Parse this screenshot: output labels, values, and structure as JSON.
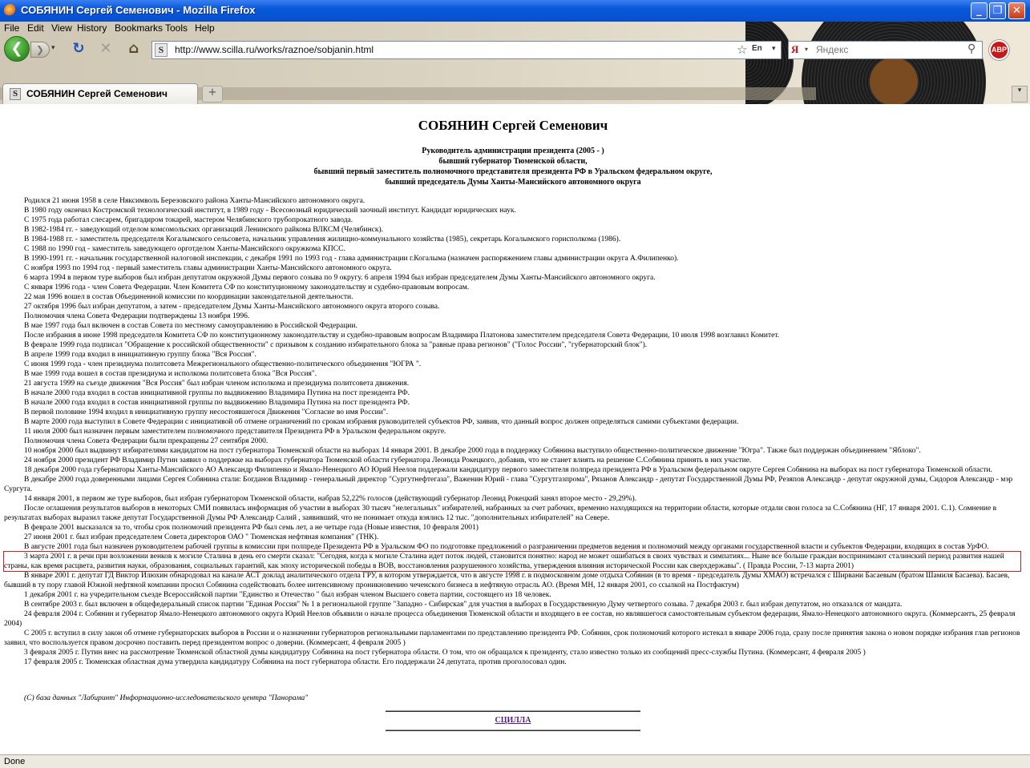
{
  "window": {
    "title": "СОБЯНИН Сергей Семенович - Mozilla Firefox",
    "min": "_",
    "max": "❐",
    "close": "✕"
  },
  "menu": [
    "File",
    "Edit",
    "View",
    "History",
    "Bookmarks",
    "Tools",
    "Help"
  ],
  "nav": {
    "back": "❮",
    "forward": "❯",
    "reload": "↻",
    "stop": "✕",
    "home": "⌂",
    "url": "http://www.scilla.ru/works/raznoe/sobjanin.html",
    "site_icon": "S",
    "star": "☆",
    "lang": "En",
    "search_engine": "Я",
    "search_placeholder": "Яндекс",
    "abp": "ABP"
  },
  "tab": {
    "favicon": "S",
    "label": "СОБЯНИН Сергей Семенович",
    "new_tab": "+",
    "all_tabs": "▾"
  },
  "page": {
    "title": "СОБЯНИН Сергей Семенович",
    "subtitle": [
      "Руководитель администрации президента (2005 - )",
      "бывший губернатор Тюменской области,",
      "бывший первый заместитель полномочного представителя президента РФ в Уральском федеральном округе,",
      "бывший председатель Думы Ханты-Мансийского автономного округа"
    ],
    "bio": [
      "Родился 21 июня 1958 в селе Няксимволь Березовского района  Ханты-Мансийского автономного округа.",
      "В 1980 году окончил Костромской технологический институт, в 1989 году - Всесоюзный юридический заочный институт. Кандидат юридических наук.",
      "С 1975 года работал слесарем, бригадиром токарей, мастером Челябинского трубопрокатного завода.",
      "В 1982-1984 гг. - заведующий отделом комсомольских организаций Ленинского райкома ВЛКСМ (Челябинск).",
      "В 1984-1988 гг. - заместитель председателя Когалымского сельсовета, начальник управления жилищно-коммунального хозяйства (1985), секретарь Когалымского горисполкома (1986).",
      "С 1988 по 1990 год - заместитель заведующего орготделом Ханты-Мансийского окружкома КПСС.",
      "В 1990-1991 гг. - начальник государственной налоговой инспекции, с декабря 1991 по 1993 год - глава администрации г.Когалыма (назначен распоряжением главы администрации округа А.Филипенко).",
      "С ноября 1993 по 1994 год - первый заместитель главы администрации Ханты-Мансийского автономного округа.",
      "6 марта 1994 в первом туре выборов был избран депутатом окружной Думы первого созыва по 9 округу.   6 апреля 1994 был избран председателем Думы Ханты-Мансийского автономного округа.",
      "С января 1996 года - член Совета Федерации. Член Комитета СФ по конституционному законодательству и судебно-правовым вопросам.",
      "22 мая 1996 вошел в состав Объединенной комиссии по координации законодательной деятельности.",
      "27 октября 1996 был избран депутатом, а затем - председателем Думы Ханты-Мансийского автономного округа второго созыва.",
      "Полномочия члена Совета Федерации подтверждены 13 ноября 1996.",
      "В мае 1997 года был включен в состав Совета по местному самоуправлению в Российской Федерации.",
      "После избрания в июне 1998 председателя Комитета СФ по конституционному законодательству и судебно-правовым вопросам Владимира Платонова заместителем председателя Совета Федерации, 10 июля 1998 возглавил Комитет.",
      "В феврале 1999 года подписал \"Обращение к российской общественности\" с призывом к созданию избирательного блока за \"равные права регионов\" (\"Голос России\", \"губернаторский блок\").",
      "В апреле 1999 года входил в инициативную группу блока \"Вся Россия\".",
      "С июня 1999 года - член президиума политсовета Межрегионального общественно-политического объединения \"ЮГРА \".",
      "В мае 1999 года вошел в состав президиума и исполкома политсовета блока \"Вся Россия\".",
      "21 августа 1999 на съезде движения \"Вся Россия\" был избран членом исполкома и президиума политсовета движения.",
      "В начале 2000 года входил в состав инициативной группы по выдвижению Владимира Путина на пост президента РФ.",
      "В начале 2000 года входил в состав инициативной группы по выдвижению Владимира Путина на пост президента РФ.",
      "В первой половине 1994 входил в инициативную группу несостоявшегося Движения \"Согласие во имя России\".",
      "В марте 2000 года выступил в Совете Федерации с инициативой об отмене ограничений по срокам избрания руководителей субъектов РФ, заявив, что данный вопрос должен определяться самими субъектами федерации.",
      "11 июля 2000 был назначен первым заместителем полномочного представителя Президента РФ в Уральском федеральном округе.",
      "Полномочия члена Совета Федерации были прекращены 27 сентября 2000.",
      "10 ноября 2000 был выдвинут избирателями кандидатом на пост губернатора Тюменской области на выборах 14 января 2001. В декабре 2000 года в поддержку Собянина выступило общественно-политическое движение \"Югра\". Также был поддержан объединением \"Яблоко\".",
      "24 ноября 2000 президент РФ Владимир Путин заявил о поддержке на выборах губернатора Тюменской области губернатора Леонида Рокецкого, добавив, что не станет влиять на решение С.Собянина принять в них участие.",
      "18 декабря 2000 года губернаторы Ханты-Мансийского АО Александр Филипенко и Ямало-Ненецкого АО Юрий Неелов поддержали кандидатуру первого заместителя полпреда президента РФ в Уральском федеральном округе Сергея Собянина на выборах на пост губернатора Тюменской области.",
      "В декабре 2000 года доверенными лицами Сергея Собянина стали: Богданов  Владимир - генеральный директор \"Сургутнефтегаза\", Важенин  Юрий - глава \"Сургутгазпрома\", Рязанов  Александр - депутат Государственной Думы РФ, Резяпов  Александр - депутат окружной думы, Сидоров Александр - мэр Сургута.",
      "14 января 2001, в первом же туре выборов, был избран губернатором Тюменской области, набрав 52,22% голосов (действующий губернатор Леонид Рокецкий занял второе место - 29,29%).",
      "После оглашения результатов выборов в некоторых СМИ появилась информация об участии в выборах 30 тысяч \"нелегальных\" избирателей, набранных за счет рабочих, временно находящихся на территории области, которые отдали свои голоса за С.Собянина (НГ, 17 января 2001. С.1). Сомнение в результатах выборах выразил также депутат Государственной Думы РФ Александр Салий , заявивший, что не понимает откуда взялись 12 тыс. \"дополнительных избирателей\" на Севере.",
      "В феврале 2001 высказался за то, чтобы срок полномочий президента РФ был семь лет, а не четыре года (Новые известия, 10 февраля 2001)",
      "27 июня 2001 г. был избран председателем Совета директоров ОАО \" Тюменская нефтяная компания\" (ТНК).",
      "В августе 2001 года был назначен руководителем рабочей группы в комиссии при полпреде Президента РФ в Уральском ФО по подготовке предложений о разграничении предметов ведения и полномочий между органами государственной власти и субъектов Федерации, входящих в состав УрФО.",
      "3 марта 2001 г. в речи при возложении венков к могиле Сталина в день его смерти сказал: \"Сегодня, когда к могиле Сталина идет поток людей, становится понятно: народ не может ошибаться в своих чувствах и симпатиях... Ныне все больше граждан воспринимают сталинский период развития нашей страны, как время расцвета, развития науки, образования, социальных гарантий, как эпоху исторической победы в ВОВ, восстановления разрушенного хозяйства, утверждения влияния исторической России как сверхдержавы\". ( Правда России, 7-13 марта 2001)",
      "В январе 2001 г.  депутат ГД Виктор Илюхин обнародовал на канале АСТ доклад аналитического отдела ГРУ, в котором утверждается, что в августе 1998 г. в подмосковном доме отдыха Собянин (в то время - председатель Думы ХМАО) встречался с Ширвани Басаевым (братом Шамиля Басаева). Басаев, бывший в ту пору главой Южной нефтяной компании просил Собянина содействовать более интенсивному проникновению чеченского бизнеса в нефтяную отрасль АО. (Время МН, 12 января 2001, со ссылкой на Постфактум)",
      "1 декабря 2001 г. на учредительном съезде Всероссийской партии \"Единство и Отечество \" был избран членом Высшего совета партии, состоящего из 18 человек.",
      "В сентябре 2003 г. был включен в общефедеральный список партии \"Единая Россия\" № 1 в региональной группе \"Западно - Сибирская\" для участия в выборах в Государственную Думу четвертого созыва. 7 декабря 2003 г. был избран депутатом, но отказался от мандата.",
      "24 февраля 2004 г. Собянин и губернатор Ямало-Ненецкого автономного округа Юрий Неелов объявили о начале процесса объединения  Тюменской области и входящего в ее состав, но являвшегося самостоятельным субъектом федерации,  Ямало-Ненецкого автономного округа.  (Коммерсантъ, 25 февраля 2004)",
      "С 2005 г. вступил в силу закон об отмене губернаторских выборов в России и о назначении губернаторов региональными парламентами по представлению президента РФ. Собянин, срок полномочий которого истекал в январе 2006 года, сразу после принятия закона о новом порядке избрания глав регионов заявил, что воспользуется правом досрочно поставить перед президентом вопрос о доверии. (Коммерсант, 4 февраля 2005 )",
      "3 февраля 2005 г. Путин внес на рассмотрение Тюменской областной думы кандидатуру  Собянина на пост губернатора области. О том, что он обращался к президенту, стало известно только из сообщений пресс-службы Путина. (Коммерсант, 4 февраля 2005 )",
      "17 февраля 2005 г. Тюменская областная дума утвердила кандидатуру Собянина на пост губернатора области. Его поддержали 24 депутата, против проголосовал один."
    ],
    "highlight_index": 35,
    "source": "(С) база данных \"Лабиринт\" Информационно-исследовательского центра \"Панорама\"",
    "link": "СЦИЛЛА"
  },
  "status": "Done"
}
